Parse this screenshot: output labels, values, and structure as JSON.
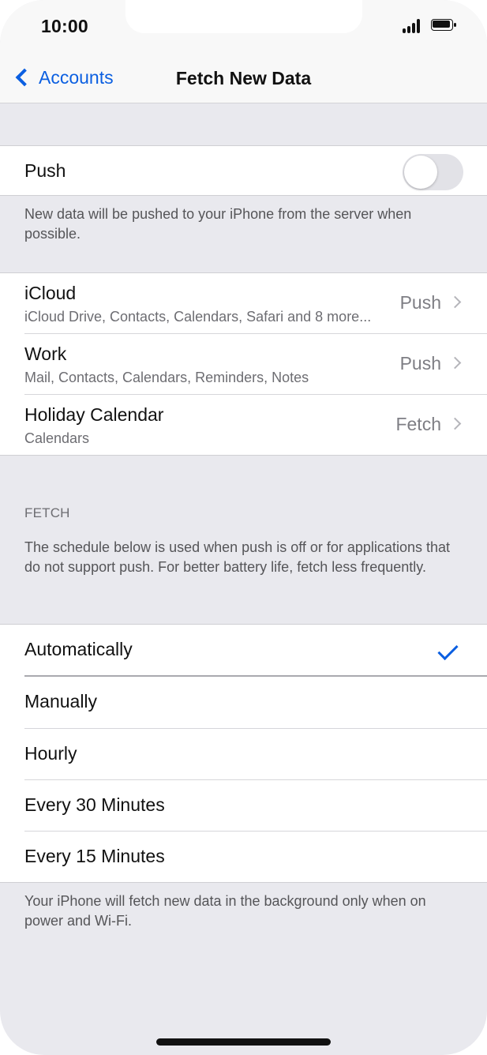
{
  "status_bar": {
    "time": "10:00",
    "signal_icon": "cellular-signal-icon",
    "battery_icon": "battery-icon"
  },
  "navigation": {
    "back_label": "Accounts",
    "title": "Fetch New Data",
    "back_icon": "chevron-left-icon"
  },
  "push": {
    "label": "Push",
    "enabled": false,
    "description": "New data will be pushed to your iPhone from the server when possible."
  },
  "accounts": [
    {
      "title": "iCloud",
      "subtitle": "iCloud Drive, Contacts, Calendars, Safari and 8 more...",
      "value": "Push"
    },
    {
      "title": "Work",
      "subtitle": "Mail, Contacts, Calendars, Reminders, Notes",
      "value": "Push"
    },
    {
      "title": "Holiday Calendar",
      "subtitle": "Calendars",
      "value": "Fetch"
    }
  ],
  "fetch": {
    "header": "FETCH",
    "description": "The schedule below is used when push is off or for applications that do not support push. For better battery life, fetch less frequently."
  },
  "schedule": {
    "options": [
      "Automatically",
      "Manually",
      "Hourly",
      "Every 30 Minutes",
      "Every 15 Minutes"
    ],
    "selected": "Automatically",
    "footer": "Your iPhone will fetch new data in the background only when on power and Wi-Fi."
  },
  "colors": {
    "accent": "#0b5fe1",
    "background": "#e9e9ee",
    "secondary_text": "#6d6d72",
    "value_text": "#7e7e84"
  }
}
